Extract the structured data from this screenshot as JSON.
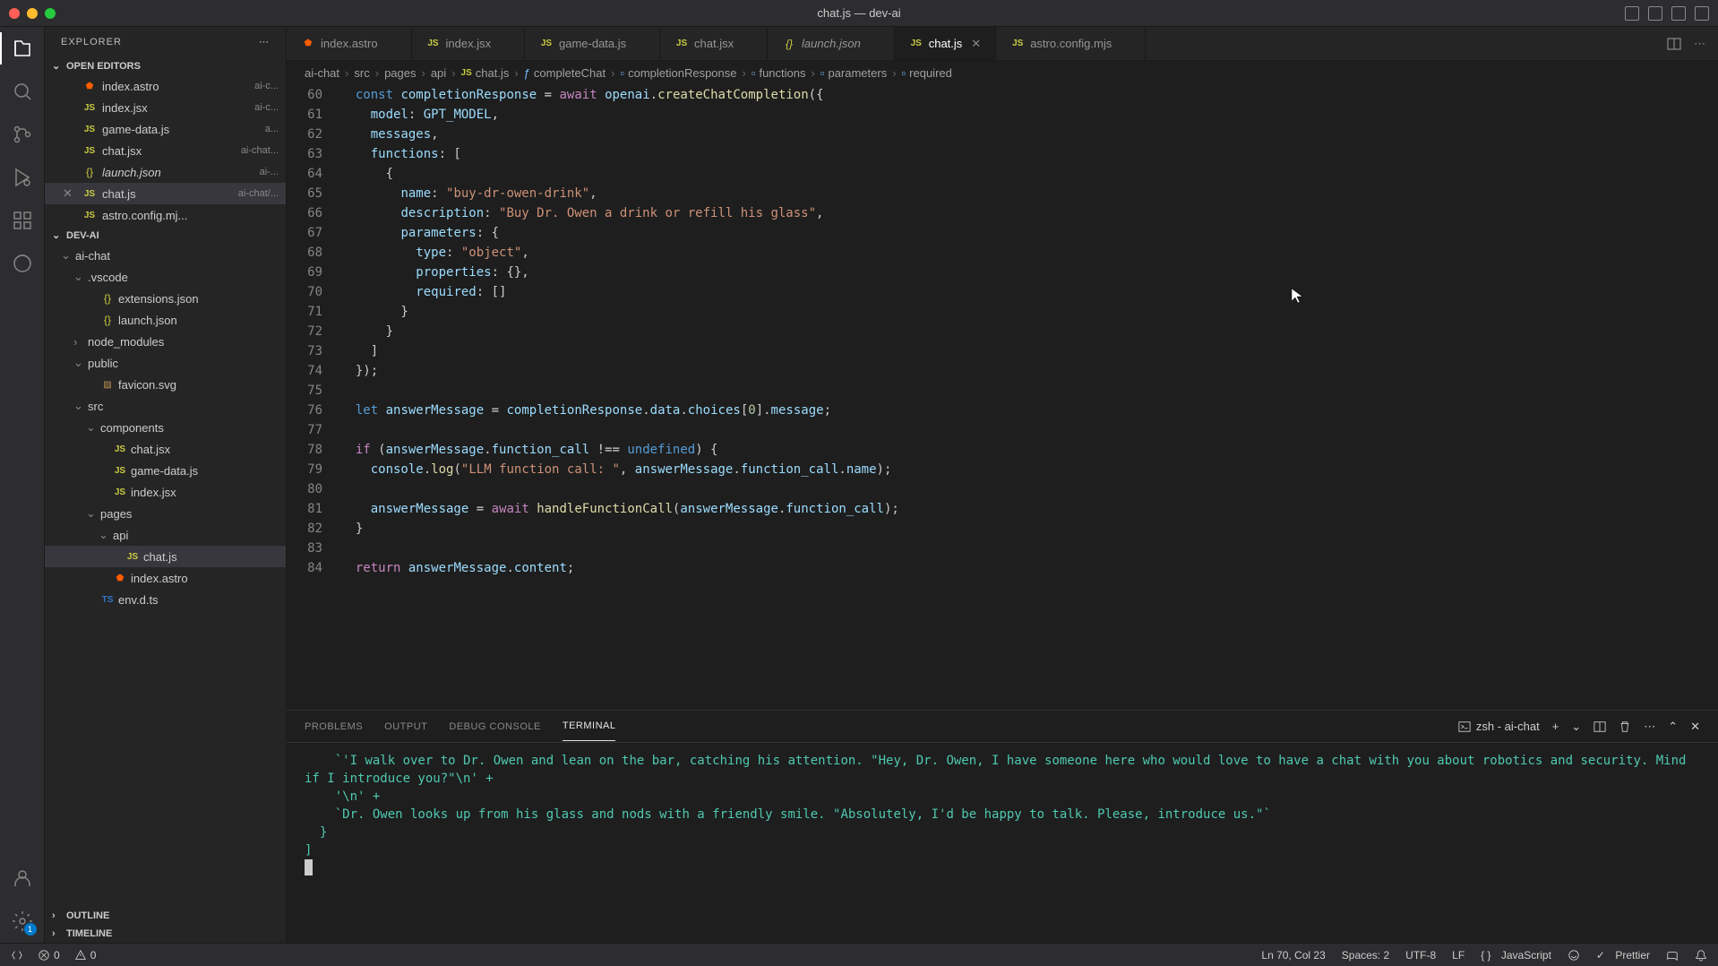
{
  "window": {
    "title": "chat.js — dev-ai"
  },
  "sidebar": {
    "title": "EXPLORER",
    "sections": {
      "openEditors": "OPEN EDITORS",
      "project": "DEV-AI",
      "outline": "OUTLINE",
      "timeline": "TIMELINE"
    }
  },
  "openEditors": [
    {
      "name": "index.astro",
      "dim": "ai-c...",
      "iconClass": "ic-astro",
      "iconText": "⬟"
    },
    {
      "name": "index.jsx",
      "dim": "ai-c...",
      "iconClass": "ic-js",
      "iconText": "JS"
    },
    {
      "name": "game-data.js",
      "dim": "a...",
      "iconClass": "ic-js",
      "iconText": "JS"
    },
    {
      "name": "chat.jsx",
      "dim": "ai-chat...",
      "iconClass": "ic-js",
      "iconText": "JS"
    },
    {
      "name": "launch.json",
      "dim": "ai-...",
      "iconClass": "ic-json",
      "iconText": "{}",
      "italic": true
    },
    {
      "name": "chat.js",
      "dim": "ai-chat/...",
      "iconClass": "ic-js",
      "iconText": "JS",
      "active": true
    },
    {
      "name": "astro.config.mj...",
      "dim": "",
      "iconClass": "ic-js",
      "iconText": "JS"
    }
  ],
  "tree": [
    {
      "name": "ai-chat",
      "indent": 1,
      "chev": "⌄"
    },
    {
      "name": ".vscode",
      "indent": 2,
      "chev": "⌄"
    },
    {
      "name": "extensions.json",
      "indent": 3,
      "iconClass": "ic-json",
      "iconText": "{}"
    },
    {
      "name": "launch.json",
      "indent": 3,
      "iconClass": "ic-json",
      "iconText": "{}"
    },
    {
      "name": "node_modules",
      "indent": 2,
      "chev": "›"
    },
    {
      "name": "public",
      "indent": 2,
      "chev": "⌄"
    },
    {
      "name": "favicon.svg",
      "indent": 3,
      "iconClass": "ic-svg",
      "iconText": "▨"
    },
    {
      "name": "src",
      "indent": 2,
      "chev": "⌄"
    },
    {
      "name": "components",
      "indent": 3,
      "chev": "⌄"
    },
    {
      "name": "chat.jsx",
      "indent": 4,
      "iconClass": "ic-js",
      "iconText": "JS"
    },
    {
      "name": "game-data.js",
      "indent": 4,
      "iconClass": "ic-js",
      "iconText": "JS"
    },
    {
      "name": "index.jsx",
      "indent": 4,
      "iconClass": "ic-js",
      "iconText": "JS"
    },
    {
      "name": "pages",
      "indent": 3,
      "chev": "⌄"
    },
    {
      "name": "api",
      "indent": 4,
      "chev": "⌄"
    },
    {
      "name": "chat.js",
      "indent": 5,
      "iconClass": "ic-js",
      "iconText": "JS",
      "selected": true
    },
    {
      "name": "index.astro",
      "indent": 4,
      "iconClass": "ic-astro",
      "iconText": "⬟"
    },
    {
      "name": "env.d.ts",
      "indent": 3,
      "iconClass": "ic-ts",
      "iconText": "TS"
    }
  ],
  "tabs": [
    {
      "label": "index.astro",
      "iconClass": "ic-astro",
      "iconText": "⬟"
    },
    {
      "label": "index.jsx",
      "iconClass": "ic-js",
      "iconText": "JS"
    },
    {
      "label": "game-data.js",
      "iconClass": "ic-js",
      "iconText": "JS"
    },
    {
      "label": "chat.jsx",
      "iconClass": "ic-js",
      "iconText": "JS"
    },
    {
      "label": "launch.json",
      "iconClass": "ic-json",
      "iconText": "{}",
      "italic": true
    },
    {
      "label": "chat.js",
      "iconClass": "ic-js",
      "iconText": "JS",
      "active": true
    },
    {
      "label": "astro.config.mjs",
      "iconClass": "ic-js",
      "iconText": "JS"
    }
  ],
  "breadcrumb": [
    {
      "text": "ai-chat"
    },
    {
      "text": "src"
    },
    {
      "text": "pages"
    },
    {
      "text": "api"
    },
    {
      "text": "chat.js",
      "iconClass": "ic-js",
      "iconText": "JS"
    },
    {
      "text": "completeChat",
      "sym": "ƒ"
    },
    {
      "text": "completionResponse",
      "sym": "▫"
    },
    {
      "text": "functions",
      "sym": "▫"
    },
    {
      "text": "parameters",
      "sym": "▫"
    },
    {
      "text": "required",
      "sym": "▫"
    }
  ],
  "code": {
    "startLine": 60,
    "lines": [
      "  <span class='tok-const'>const</span> <span class='tok-var'>completionResponse</span> <span class='tok-op'>=</span> <span class='tok-kw'>await</span> <span class='tok-var'>openai</span>.<span class='tok-fn'>createChatCompletion</span>({",
      "    <span class='tok-prop'>model</span>: <span class='tok-var'>GPT_MODEL</span>,",
      "    <span class='tok-prop'>messages</span>,",
      "    <span class='tok-prop'>functions</span>: [",
      "      {",
      "        <span class='tok-prop'>name</span>: <span class='tok-str'>\"buy-dr-owen-drink\"</span>,",
      "        <span class='tok-prop'>description</span>: <span class='tok-str'>\"Buy Dr. Owen a drink or refill his glass\"</span>,",
      "        <span class='tok-prop'>parameters</span>: {",
      "          <span class='tok-prop'>type</span>: <span class='tok-str'>\"object\"</span>,",
      "          <span class='tok-prop'>properties</span>: {},",
      "          <span class='tok-prop'>required</span>: []",
      "        }",
      "      }",
      "    ]",
      "  });",
      "",
      "  <span class='tok-const'>let</span> <span class='tok-var'>answerMessage</span> <span class='tok-op'>=</span> <span class='tok-var'>completionResponse</span>.<span class='tok-var'>data</span>.<span class='tok-var'>choices</span>[<span class='tok-num'>0</span>].<span class='tok-var'>message</span>;",
      "",
      "  <span class='tok-kw'>if</span> (<span class='tok-var'>answerMessage</span>.<span class='tok-var'>function_call</span> <span class='tok-op'>!==</span> <span class='tok-undef'>undefined</span>) {",
      "    <span class='tok-var'>console</span>.<span class='tok-fn'>log</span>(<span class='tok-str'>\"LLM function call: \"</span>, <span class='tok-var'>answerMessage</span>.<span class='tok-var'>function_call</span>.<span class='tok-var'>name</span>);",
      "",
      "    <span class='tok-var'>answerMessage</span> <span class='tok-op'>=</span> <span class='tok-kw'>await</span> <span class='tok-fn'>handleFunctionCall</span>(<span class='tok-var'>answerMessage</span>.<span class='tok-var'>function_call</span>);",
      "  }",
      "",
      "  <span class='tok-kw'>return</span> <span class='tok-var'>answerMessage</span>.<span class='tok-var'>content</span>;"
    ]
  },
  "panel": {
    "tabs": {
      "problems": "PROBLEMS",
      "output": "OUTPUT",
      "debug": "DEBUG CONSOLE",
      "terminal": "TERMINAL"
    },
    "shell": "zsh - ai-chat",
    "terminalText": "    `'I walk over to Dr. Owen and lean on the bar, catching his attention. \"Hey, Dr. Owen, I have someone here who would love to have a chat with you about robotics and security. Mind if I introduce you?\"\\n' +\n    '\\n' +\n    `Dr. Owen looks up from his glass and nods with a friendly smile. \"Absolutely, I'd be happy to talk. Please, introduce us.\"`\n  }\n]"
  },
  "status": {
    "errors": "0",
    "warnings": "0",
    "lineCol": "Ln 70, Col 23",
    "spaces": "Spaces: 2",
    "encoding": "UTF-8",
    "eol": "LF",
    "lang": "JavaScript",
    "prettier": "Prettier"
  }
}
